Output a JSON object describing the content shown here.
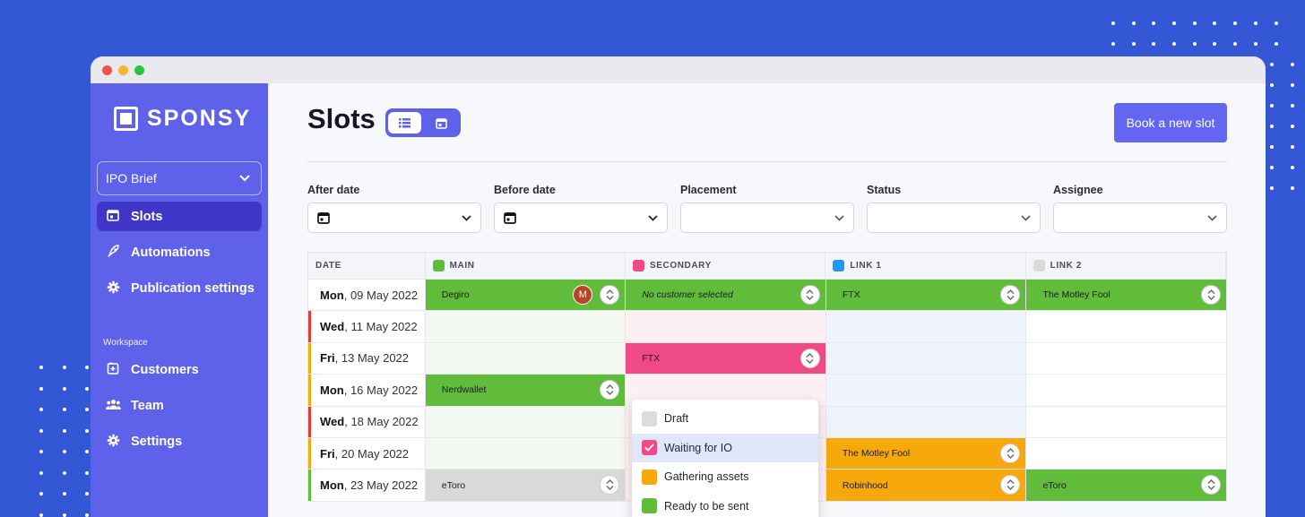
{
  "app": {
    "logo_text": "SPONSY"
  },
  "sidebar": {
    "workspace_select": "IPO Brief",
    "items": [
      {
        "label": "Slots",
        "icon": "calendar-icon",
        "active": true
      },
      {
        "label": "Automations",
        "icon": "rocket-icon",
        "active": false
      },
      {
        "label": "Publication settings",
        "icon": "gear-icon",
        "active": false
      }
    ],
    "section_label": "Workspace",
    "workspace_items": [
      {
        "label": "Customers",
        "icon": "add-box-icon"
      },
      {
        "label": "Team",
        "icon": "group-icon"
      },
      {
        "label": "Settings",
        "icon": "gear-icon"
      }
    ]
  },
  "header": {
    "title": "Slots",
    "book_button": "Book a new slot",
    "view_modes": [
      "list",
      "calendar"
    ],
    "active_view": "list"
  },
  "filters": [
    {
      "label": "After date",
      "value": ""
    },
    {
      "label": "Before date",
      "value": ""
    },
    {
      "label": "Placement",
      "value": ""
    },
    {
      "label": "Status",
      "value": ""
    },
    {
      "label": "Assignee",
      "value": ""
    }
  ],
  "table": {
    "columns": [
      {
        "label": "DATE",
        "color": null
      },
      {
        "label": "MAIN",
        "color": "#62bc3b"
      },
      {
        "label": "SECONDARY",
        "color": "#f04a86"
      },
      {
        "label": "LINK 1",
        "color": "#2196f3"
      },
      {
        "label": "LINK 2",
        "color": "#d9d9d9"
      }
    ],
    "rows": [
      {
        "day": "Mon",
        "date": ", 09 May 2022",
        "marker": "#ffffff",
        "cells": [
          {
            "text": "Degiro",
            "fill": "green",
            "avatar": "M"
          },
          {
            "text": "No customer selected",
            "fill": "green",
            "italic": true
          },
          {
            "text": "FTX",
            "fill": "green"
          },
          {
            "text": "The Motley Fool",
            "fill": "green"
          }
        ]
      },
      {
        "day": "Wed",
        "date": ", 11 May 2022",
        "marker": "#e53935",
        "cells": [
          null,
          null,
          null,
          null
        ]
      },
      {
        "day": "Fri",
        "date": ", 13 May 2022",
        "marker": "#f7a80a",
        "cells": [
          null,
          {
            "text": "FTX",
            "fill": "pink"
          },
          null,
          null
        ]
      },
      {
        "day": "Mon",
        "date": ", 16 May 2022",
        "marker": "#f7a80a",
        "cells": [
          {
            "text": "Nerdwallet",
            "fill": "green"
          },
          null,
          null,
          null
        ]
      },
      {
        "day": "Wed",
        "date": ", 18 May 2022",
        "marker": "#e53935",
        "cells": [
          null,
          null,
          null,
          null
        ]
      },
      {
        "day": "Fri",
        "date": ", 20 May 2022",
        "marker": "#f7a80a",
        "cells": [
          null,
          null,
          {
            "text": "The Motley Fool",
            "fill": "orange"
          },
          null
        ]
      },
      {
        "day": "Mon",
        "date": ", 23 May 2022",
        "marker": "#62bc3b",
        "cells": [
          {
            "text": "eToro",
            "fill": "grey"
          },
          null,
          {
            "text": "Robinhood",
            "fill": "orange"
          },
          {
            "text": "eToro",
            "fill": "green"
          }
        ]
      }
    ]
  },
  "status_dropdown": {
    "options": [
      {
        "label": "Draft",
        "color": "#dcdcdc",
        "selected": false
      },
      {
        "label": "Waiting for IO",
        "color": "#f04a86",
        "selected": true
      },
      {
        "label": "Gathering assets",
        "color": "#f7a80a",
        "selected": false
      },
      {
        "label": "Ready to be sent",
        "color": "#62bc3b",
        "selected": false
      }
    ]
  },
  "colors": {
    "brand": "#5e62ea",
    "background": "#3457d5"
  }
}
